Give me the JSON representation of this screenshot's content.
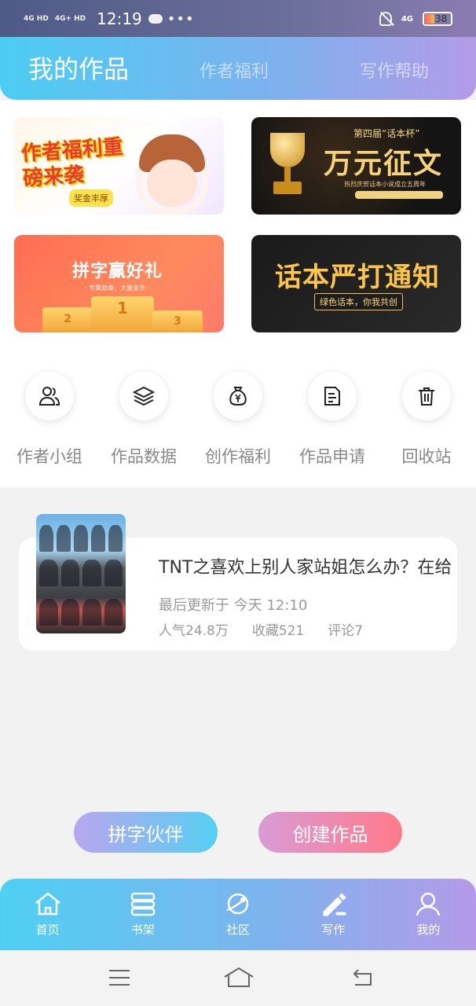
{
  "status_bar": {
    "signal1": "4G HD",
    "signal2": "4G+ HD",
    "time": "12:19",
    "dots": "•••",
    "network": "4G",
    "battery": "38"
  },
  "header": {
    "tab_active": "我的作品",
    "tab_2": "作者福利",
    "tab_3": "写作帮助"
  },
  "banners": {
    "b1": {
      "title": "作者福利重磅来袭",
      "chip": "奖金丰厚"
    },
    "b2": {
      "sub": "第四届“话本杯”",
      "title": "万元征文",
      "small": "热烈庆贺话本小说成立五周年"
    },
    "b3": {
      "title": "拼字赢好礼",
      "sub": "· 专属勋章，大量金币 ·",
      "p1": "1",
      "p2": "2",
      "p3": "3"
    },
    "b4": {
      "title": "话本严打通知",
      "pill": "绿色话本，你我共创"
    }
  },
  "shortcuts": [
    {
      "label": "作者小组",
      "icon": "users-icon"
    },
    {
      "label": "作品数据",
      "icon": "layers-icon"
    },
    {
      "label": "创作福利",
      "icon": "money-bag-icon"
    },
    {
      "label": "作品申请",
      "icon": "document-icon"
    },
    {
      "label": "回收站",
      "icon": "trash-icon"
    }
  ],
  "work": {
    "title": "TNT之喜欢上别人家站姐怎么办？在给",
    "updated": "最后更新于 今天 12:10",
    "popularity": "人气24.8万",
    "favorites": "收藏521",
    "comments": "评论7"
  },
  "actions": {
    "partner": "拼字伙伴",
    "create": "创建作品"
  },
  "bottom_nav": [
    {
      "label": "首页",
      "icon": "home-icon"
    },
    {
      "label": "书架",
      "icon": "bookshelf-icon"
    },
    {
      "label": "社区",
      "icon": "planet-icon"
    },
    {
      "label": "写作",
      "icon": "pen-icon"
    },
    {
      "label": "我的",
      "icon": "user-icon"
    }
  ],
  "colors": {
    "accent_cyan": "#4ccdf2",
    "accent_purple": "#b39be8",
    "accent_pink": "#ff7a8a"
  }
}
